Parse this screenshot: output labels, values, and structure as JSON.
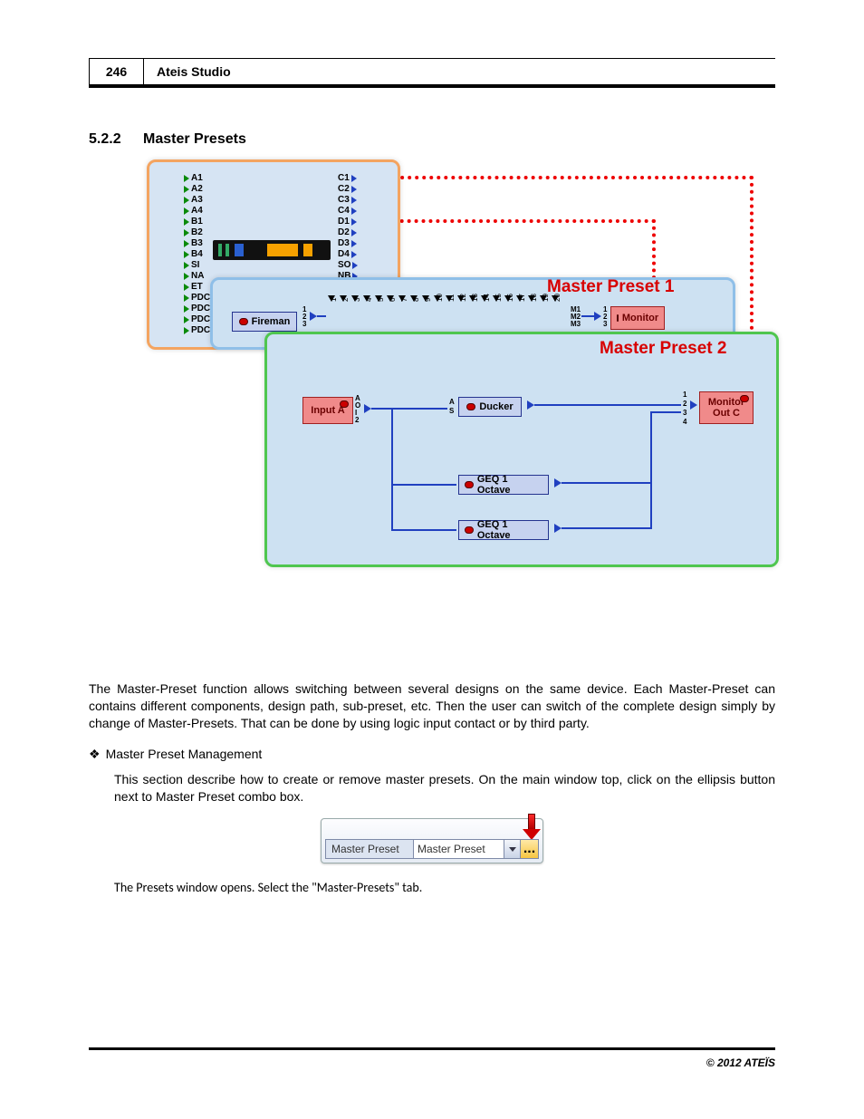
{
  "header": {
    "page_number": "246",
    "chapter": "Ateis Studio"
  },
  "section": {
    "number": "5.2.2",
    "title": "Master Presets"
  },
  "figure1": {
    "ports_left": [
      "A1",
      "A2",
      "A3",
      "A4",
      "B1",
      "B2",
      "B3",
      "B4",
      "SI",
      "NA",
      "ET",
      "PDC",
      "PDC",
      "PDC",
      "PDC"
    ],
    "ports_mid": [
      "C1",
      "C2",
      "C3",
      "C4",
      "D1",
      "D2",
      "D3",
      "D4",
      "SO",
      "NB"
    ],
    "preset1_title": "Master Preset 1",
    "preset2_title": "Master Preset 2",
    "ruler_labels": [
      "1",
      "2",
      "3",
      "4",
      "5",
      "6",
      "7",
      "8",
      "9",
      "10",
      "11",
      "12",
      "13",
      "14",
      "15",
      "16",
      "17",
      "18",
      "19",
      "20"
    ],
    "ruler_right_ports": [
      "M1",
      "M2",
      "M3"
    ],
    "nodes": {
      "fireman": "Fireman",
      "monitor1": "Monitor",
      "input_a": "Input A",
      "ducker": "Ducker",
      "monitor_outc_line1": "Monitor",
      "monitor_outc_line2": "Out C",
      "geq1": "GEQ 1 Octave",
      "geq2": "GEQ 1 Octave"
    },
    "small_ports": {
      "one_to_three": [
        "1",
        "2",
        "3"
      ],
      "one_to_four": [
        "1",
        "2",
        "3",
        "4"
      ],
      "a_s": [
        "A",
        "S"
      ],
      "aoi2": [
        "A",
        "O",
        "I",
        "2"
      ]
    }
  },
  "body": {
    "para1": "The Master-Preset function allows switching between several designs on the same device. Each Master-Preset can contains different components, design path, sub-preset, etc. Then the user can switch of the complete design simply by change of Master-Presets. That can be done by using logic input contact or by third party.",
    "bullet_label": "Master Preset Management",
    "para2": "This section describe how to create or remove master presets. On the main window top, click on the ellipsis button next to Master Preset combo box."
  },
  "figure2": {
    "label": "Master Preset",
    "value": "Master Preset",
    "ellipsis": "..."
  },
  "after_fig2": "The Presets window opens. Select the \"Master-Presets\" tab.",
  "footer": {
    "copyright": "© 2012 ATEÏS"
  }
}
